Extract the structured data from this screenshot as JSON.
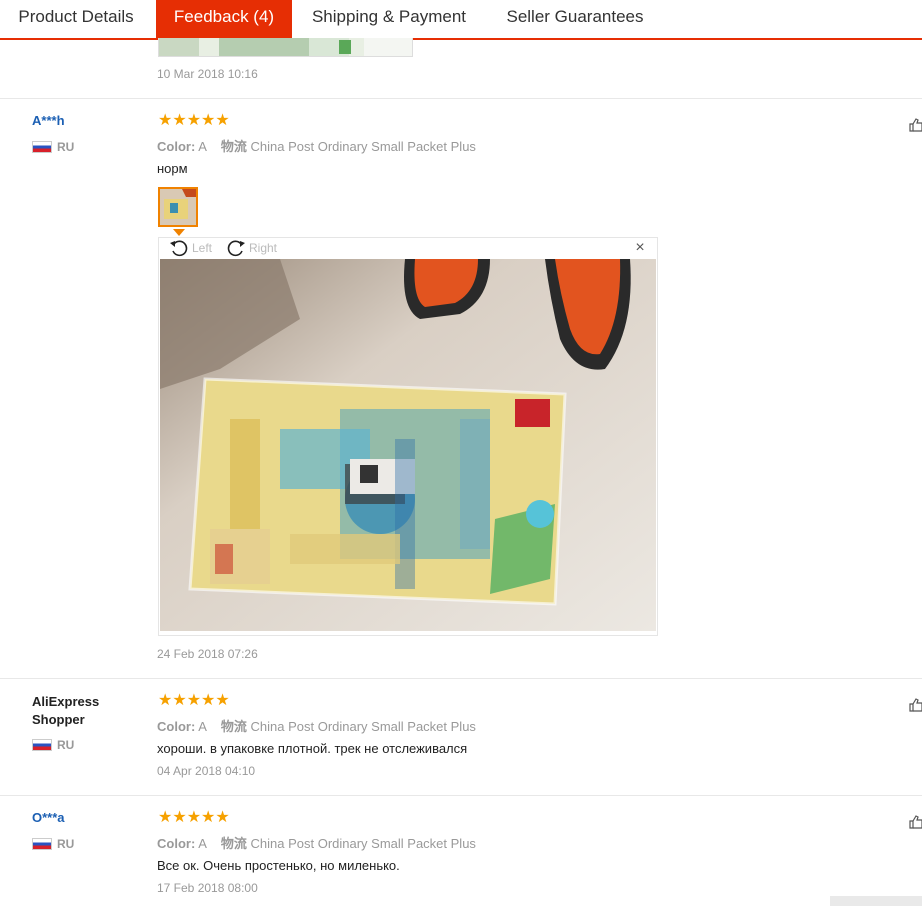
{
  "tabs": [
    {
      "label": "Product Details"
    },
    {
      "label": "Feedback (4)"
    },
    {
      "label": "Shipping & Payment"
    },
    {
      "label": "Seller Guarantees"
    }
  ],
  "colors": {
    "accent": "#e62e04",
    "star": "#f6a100",
    "link": "#1b5fb3"
  },
  "previous_review": {
    "date": "10 Mar 2018 10:16"
  },
  "reviews": [
    {
      "user": "A***h",
      "country": "RU",
      "stars": "★★★★★",
      "color_label": "Color:",
      "color_value": "A",
      "logistics_label": "物流",
      "logistics_value": "China Post Ordinary Small Packet Plus",
      "text": "норм",
      "viewer": {
        "left_label": "Left",
        "right_label": "Right",
        "close": "×"
      },
      "date": "24 Feb 2018 07:26"
    },
    {
      "user_line1": "AliExpress",
      "user_line2": "Shopper",
      "country": "RU",
      "stars": "★★★★★",
      "color_label": "Color:",
      "color_value": "A",
      "logistics_label": "物流",
      "logistics_value": "China Post Ordinary Small Packet Plus",
      "text": "хороши. в упаковке плотной. трек не отслеживался",
      "date": "04 Apr 2018 04:10"
    },
    {
      "user": "O***a",
      "country": "RU",
      "stars": "★★★★★",
      "color_label": "Color:",
      "color_value": "A",
      "logistics_label": "物流",
      "logistics_value": "China Post Ordinary Small Packet Plus",
      "text": "Все ок. Очень простенько, но миленько.",
      "date": "17 Feb 2018 08:00"
    }
  ]
}
